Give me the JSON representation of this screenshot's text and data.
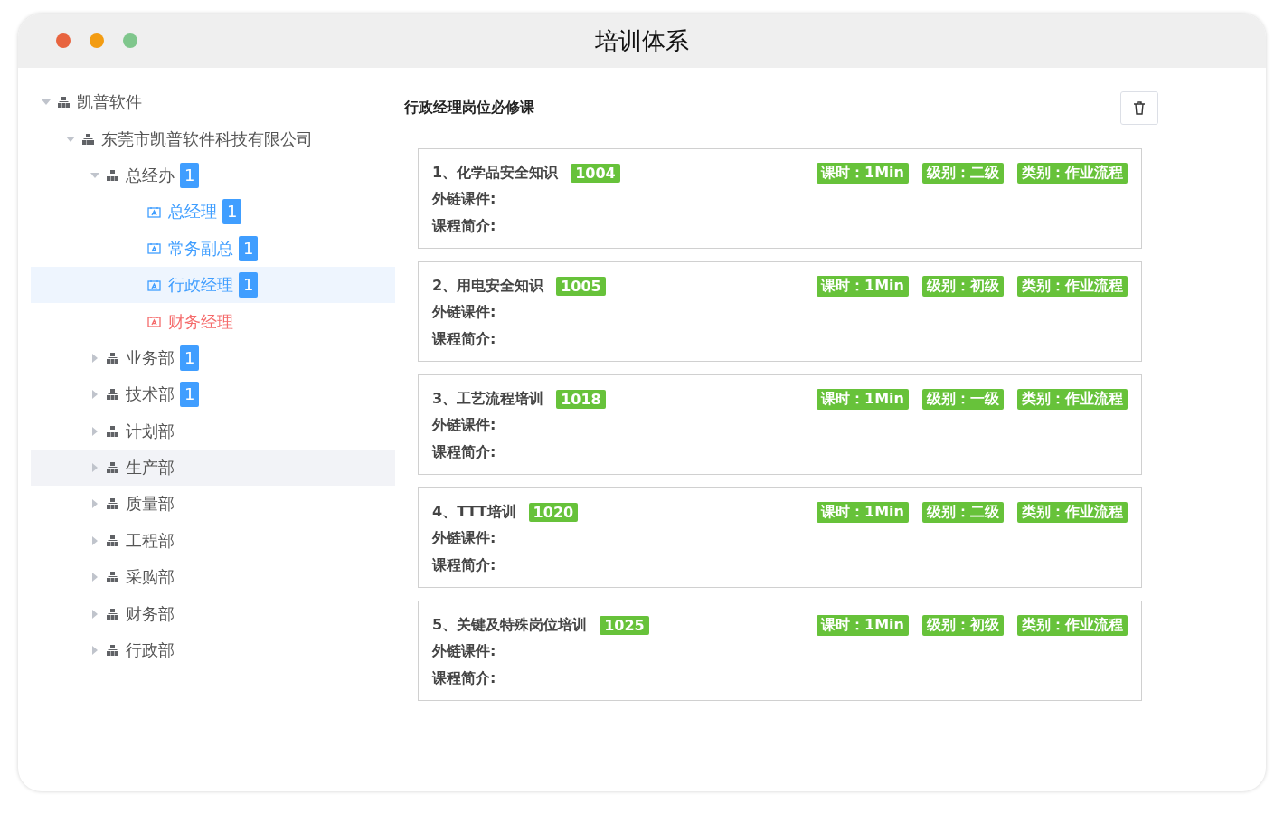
{
  "window": {
    "title": "培训体系"
  },
  "tree": [
    {
      "label": "凯普软件",
      "kind": "org",
      "expanded": true,
      "selected": false,
      "hovered": false,
      "children": [
        {
          "label": "东莞市凯普软件科技有限公司",
          "kind": "org",
          "expanded": true,
          "selected": false,
          "hovered": false,
          "children": [
            {
              "label": "总经办",
              "kind": "org",
              "expanded": true,
              "selected": false,
              "hovered": false,
              "count": "1",
              "children": [
                {
                  "label": "总经理",
                  "kind": "post",
                  "selected": false,
                  "hovered": false,
                  "color": "#409eff",
                  "count": "1"
                },
                {
                  "label": "常务副总",
                  "kind": "post",
                  "selected": false,
                  "hovered": false,
                  "color": "#409eff",
                  "count": "1"
                },
                {
                  "label": "行政经理",
                  "kind": "post",
                  "selected": true,
                  "hovered": false,
                  "color": "#409eff",
                  "count": "1"
                },
                {
                  "label": "财务经理",
                  "kind": "post",
                  "selected": false,
                  "hovered": false,
                  "color": "#f56c6c"
                }
              ]
            },
            {
              "label": "业务部",
              "kind": "org",
              "expanded": false,
              "selected": false,
              "hovered": false,
              "count": "1"
            },
            {
              "label": "技术部",
              "kind": "org",
              "expanded": false,
              "selected": false,
              "hovered": false,
              "count": "1"
            },
            {
              "label": "计划部",
              "kind": "org",
              "expanded": false,
              "selected": false,
              "hovered": false
            },
            {
              "label": "生产部",
              "kind": "org",
              "expanded": false,
              "selected": false,
              "hovered": true
            },
            {
              "label": "质量部",
              "kind": "org",
              "expanded": false,
              "selected": false,
              "hovered": false
            },
            {
              "label": "工程部",
              "kind": "org",
              "expanded": false,
              "selected": false,
              "hovered": false
            },
            {
              "label": "采购部",
              "kind": "org",
              "expanded": false,
              "selected": false,
              "hovered": false
            },
            {
              "label": "财务部",
              "kind": "org",
              "expanded": false,
              "selected": false,
              "hovered": false
            },
            {
              "label": "行政部",
              "kind": "org",
              "expanded": false,
              "selected": false,
              "hovered": false
            }
          ]
        }
      ]
    }
  ],
  "panel": {
    "title": "行政经理岗位必修课",
    "courses": [
      {
        "title": "1、化学品安全知识",
        "code": "1004",
        "tags": [
          "课时：1Min",
          "级别：二级",
          "类别：作业流程"
        ],
        "link_label": "外链课件:",
        "intro_label": "课程简介:"
      },
      {
        "title": "2、用电安全知识",
        "code": "1005",
        "tags": [
          "课时：1Min",
          "级别：初级",
          "类别：作业流程"
        ],
        "link_label": "外链课件:",
        "intro_label": "课程简介:"
      },
      {
        "title": "3、工艺流程培训",
        "code": "1018",
        "tags": [
          "课时：1Min",
          "级别：一级",
          "类别：作业流程"
        ],
        "link_label": "外链课件:",
        "intro_label": "课程简介:"
      },
      {
        "title": "4、TTT培训",
        "code": "1020",
        "tags": [
          "课时：1Min",
          "级别：二级",
          "类别：作业流程"
        ],
        "link_label": "外链课件:",
        "intro_label": "课程简介:"
      },
      {
        "title": "5、关键及特殊岗位培训",
        "code": "1025",
        "tags": [
          "课时：1Min",
          "级别：初级",
          "类别：作业流程"
        ],
        "link_label": "外链课件:",
        "intro_label": "课程简介:"
      }
    ]
  }
}
